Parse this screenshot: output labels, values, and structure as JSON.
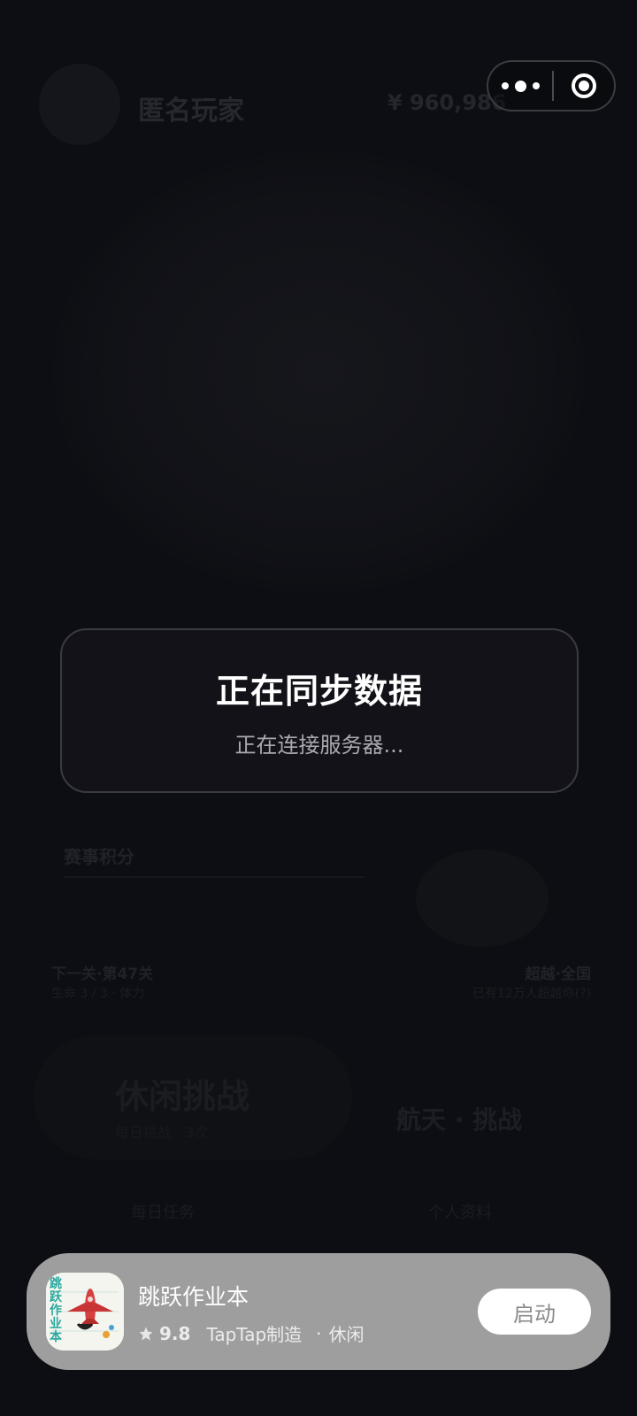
{
  "background": {
    "player_name": "匿名玩家",
    "coins": "¥ 960,986",
    "section_title": "赛事积分",
    "left_title": "下一关·第47关",
    "left_sub": "生命 3 / 3 · 体力",
    "right_title": "超越·全国",
    "right_sub": "已有12万人超越你(?)",
    "card_title": "休闲挑战",
    "card_sub": "每日挑战 · 3次",
    "card_right": "航天 · 挑战",
    "tab_left": "每日任务",
    "tab_right": "个人资料"
  },
  "capsule": {
    "more_icon": "more-dots-icon",
    "close_icon": "close-circle-icon"
  },
  "dialog": {
    "title": "正在同步数据",
    "message": "正在连接服务器..."
  },
  "banner": {
    "app_name": "跳跃作业本",
    "icon_text": "跳跃作业本",
    "rating": "9.8",
    "maker": "TapTap制造",
    "separator": "·",
    "genre": "休闲",
    "launch_label": "启动"
  },
  "colors": {
    "background": "#0d0e13",
    "dialog_bg": "#131219",
    "banner_bg": "#9e9e9e",
    "launch_text": "#8a8a8a"
  }
}
